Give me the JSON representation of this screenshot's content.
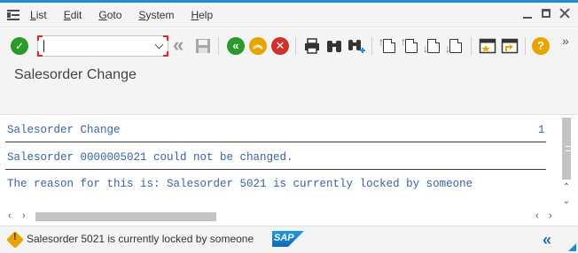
{
  "menu": {
    "items": [
      {
        "label": "List",
        "key": "L",
        "rest": "ist"
      },
      {
        "label": "Edit",
        "key": "E",
        "rest": "dit"
      },
      {
        "label": "Goto",
        "key": "G",
        "rest": "oto"
      },
      {
        "label": "System",
        "key": "S",
        "rest": "ystem"
      },
      {
        "label": "Help",
        "key": "H",
        "rest": "elp"
      }
    ]
  },
  "toolbar": {
    "command_value": "",
    "overflow_glyph": "»"
  },
  "title": "Salesorder Change",
  "list": {
    "header_left": "Salesorder Change",
    "header_right": "1",
    "line1": "Salesorder 0000005021 could not be changed.",
    "line2": "The reason for this is: Salesorder 5021 is currently locked by someone"
  },
  "status": {
    "message": "Salesorder 5021 is currently locked by someone",
    "logo_text": "SAP"
  },
  "colors": {
    "accent": "#1d89d8",
    "list_text": "#3762a4",
    "warning": "#e9a300"
  }
}
